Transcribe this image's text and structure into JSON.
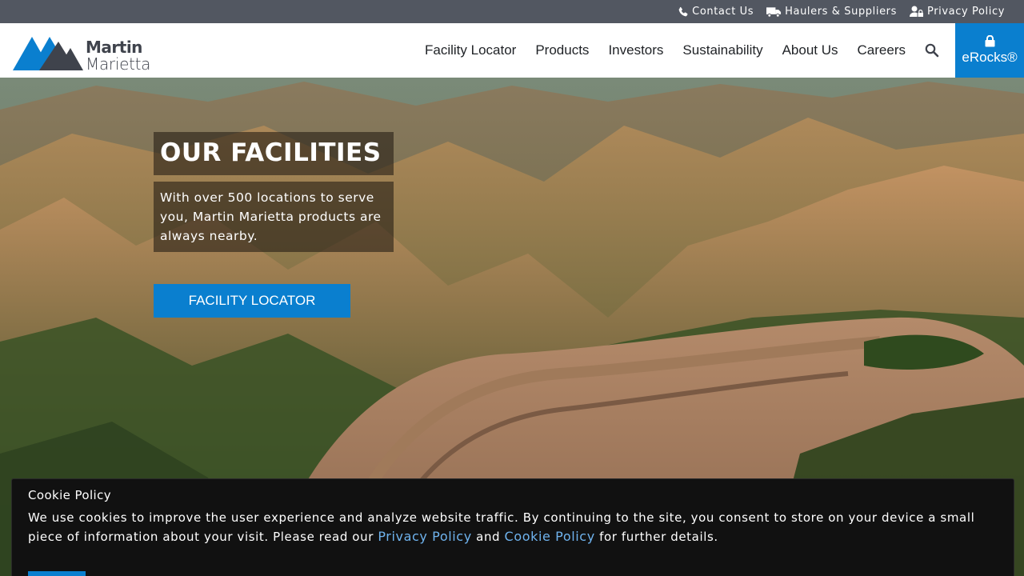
{
  "utility": {
    "contact": "Contact Us",
    "haulers": "Haulers & Suppliers",
    "privacy": "Privacy Policy"
  },
  "brand": {
    "name_line1": "Martin",
    "name_line2": "Marietta",
    "colors": {
      "primary": "#0a7fcf",
      "dark": "#3f434c",
      "utility_bar": "#525761"
    }
  },
  "nav": {
    "items": [
      "Facility Locator",
      "Products",
      "Investors",
      "Sustainability",
      "About Us",
      "Careers"
    ],
    "search_icon": "search-icon",
    "erocks_label": "eRocks®"
  },
  "hero": {
    "title": "OUR FACILITIES",
    "text": "With over 500 locations to serve you, Martin Marietta products are always nearby.",
    "cta": "FACILITY LOCATOR"
  },
  "cookie": {
    "title": "Cookie Policy",
    "text_before": "We use cookies to improve the user experience and analyze website traffic. By continuing to the site, you consent to store on your device a small piece of information about your visit. Please read our ",
    "link1": "Privacy Policy",
    "text_and": " and ",
    "link2": "Cookie Policy",
    "text_after": " for further details."
  }
}
